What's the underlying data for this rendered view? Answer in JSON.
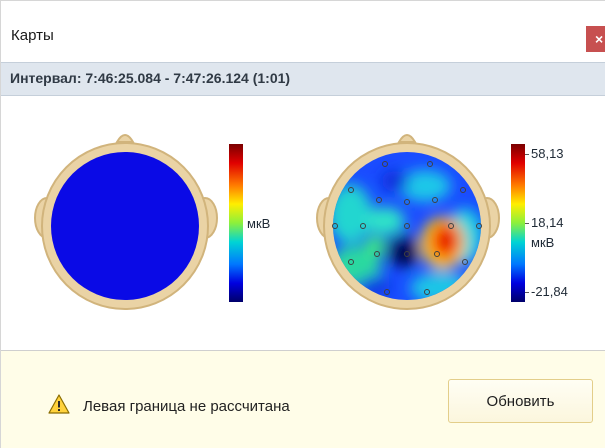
{
  "window": {
    "title": "Карты",
    "close_icon": "close-icon",
    "close_glyph": "×"
  },
  "interval": {
    "label": "Интервал: 7:46:25.084 - 7:47:26.124 (1:01)"
  },
  "maps": [
    {
      "id": "left",
      "fill": "uniform-blue",
      "colorbar_unit": "мкВ"
    },
    {
      "id": "right",
      "fill": "topographic",
      "colorbar_max": "58,13",
      "colorbar_mid": "18,14",
      "colorbar_unit": "мкВ",
      "colorbar_min": "-21,84"
    }
  ],
  "colors": {
    "head": "#ead3a5",
    "head_outline": "#d1b47c",
    "map_blue": "#0a0ae6",
    "interval_bar": "#dfe6ee",
    "notice_bg": "#fffde8",
    "close_button": "#c75050"
  },
  "notice": {
    "icon": "warning-icon",
    "text": "Левая граница не рассчитана",
    "button_label": "Обновить"
  }
}
